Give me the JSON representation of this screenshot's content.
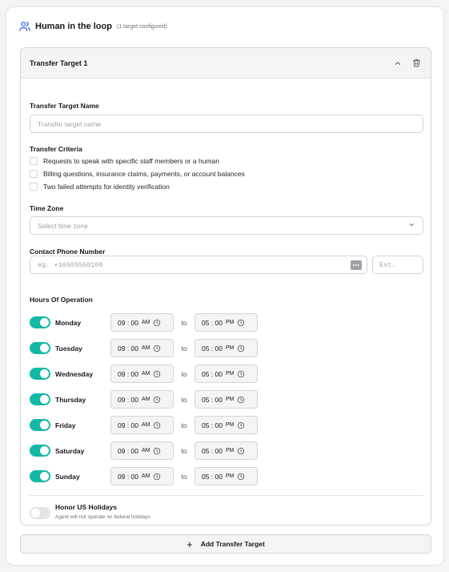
{
  "header": {
    "title": "Human in the loop",
    "subtitle": "(1 target configured)"
  },
  "target": {
    "title": "Transfer Target 1",
    "name_label": "Transfer Target Name",
    "name_placeholder": "Transfer target name",
    "criteria_label": "Transfer Criteria",
    "criteria": [
      "Requests to speak with specific staff members or a human",
      "Billing questions, insurance claims, payments, or account balances",
      "Two failed attempts for identity verification"
    ],
    "timezone_label": "Time Zone",
    "timezone_placeholder": "Select time zone",
    "phone_label": "Contact Phone Number",
    "phone_placeholder": "eg. +16505550100",
    "ext_placeholder": "Ext.",
    "hours_label": "Hours Of Operation",
    "to_label": "to",
    "days": [
      {
        "name": "Monday",
        "start": "09 : 00",
        "start_ampm": "AM",
        "end": "05 : 00",
        "end_ampm": "PM"
      },
      {
        "name": "Tuesday",
        "start": "09 : 00",
        "start_ampm": "AM",
        "end": "05 : 00",
        "end_ampm": "PM"
      },
      {
        "name": "Wednesday",
        "start": "09 : 00",
        "start_ampm": "AM",
        "end": "05 : 00",
        "end_ampm": "PM"
      },
      {
        "name": "Thursday",
        "start": "09 : 00",
        "start_ampm": "AM",
        "end": "05 : 00",
        "end_ampm": "PM"
      },
      {
        "name": "Friday",
        "start": "09 : 00",
        "start_ampm": "AM",
        "end": "05 : 00",
        "end_ampm": "PM"
      },
      {
        "name": "Saturday",
        "start": "09 : 00",
        "start_ampm": "AM",
        "end": "05 : 00",
        "end_ampm": "PM"
      },
      {
        "name": "Sunday",
        "start": "09 : 00",
        "start_ampm": "AM",
        "end": "05 : 00",
        "end_ampm": "PM"
      }
    ],
    "holidays_title": "Honor US Holidays",
    "holidays_subtitle": "Agent will not operate on federal holidays"
  },
  "add_button_label": "Add Transfer Target",
  "colors": {
    "toggle_on": "#14b8a6",
    "toggle_off": "#e4e4e7",
    "header_icon": "#2563eb"
  },
  "icons": {
    "header": "users-icon",
    "collapse": "chevron-up-icon",
    "delete": "trash-icon",
    "select": "chevron-down-icon",
    "phone_picker": "dots-icon",
    "time": "clock-icon",
    "add": "plus-icon"
  }
}
